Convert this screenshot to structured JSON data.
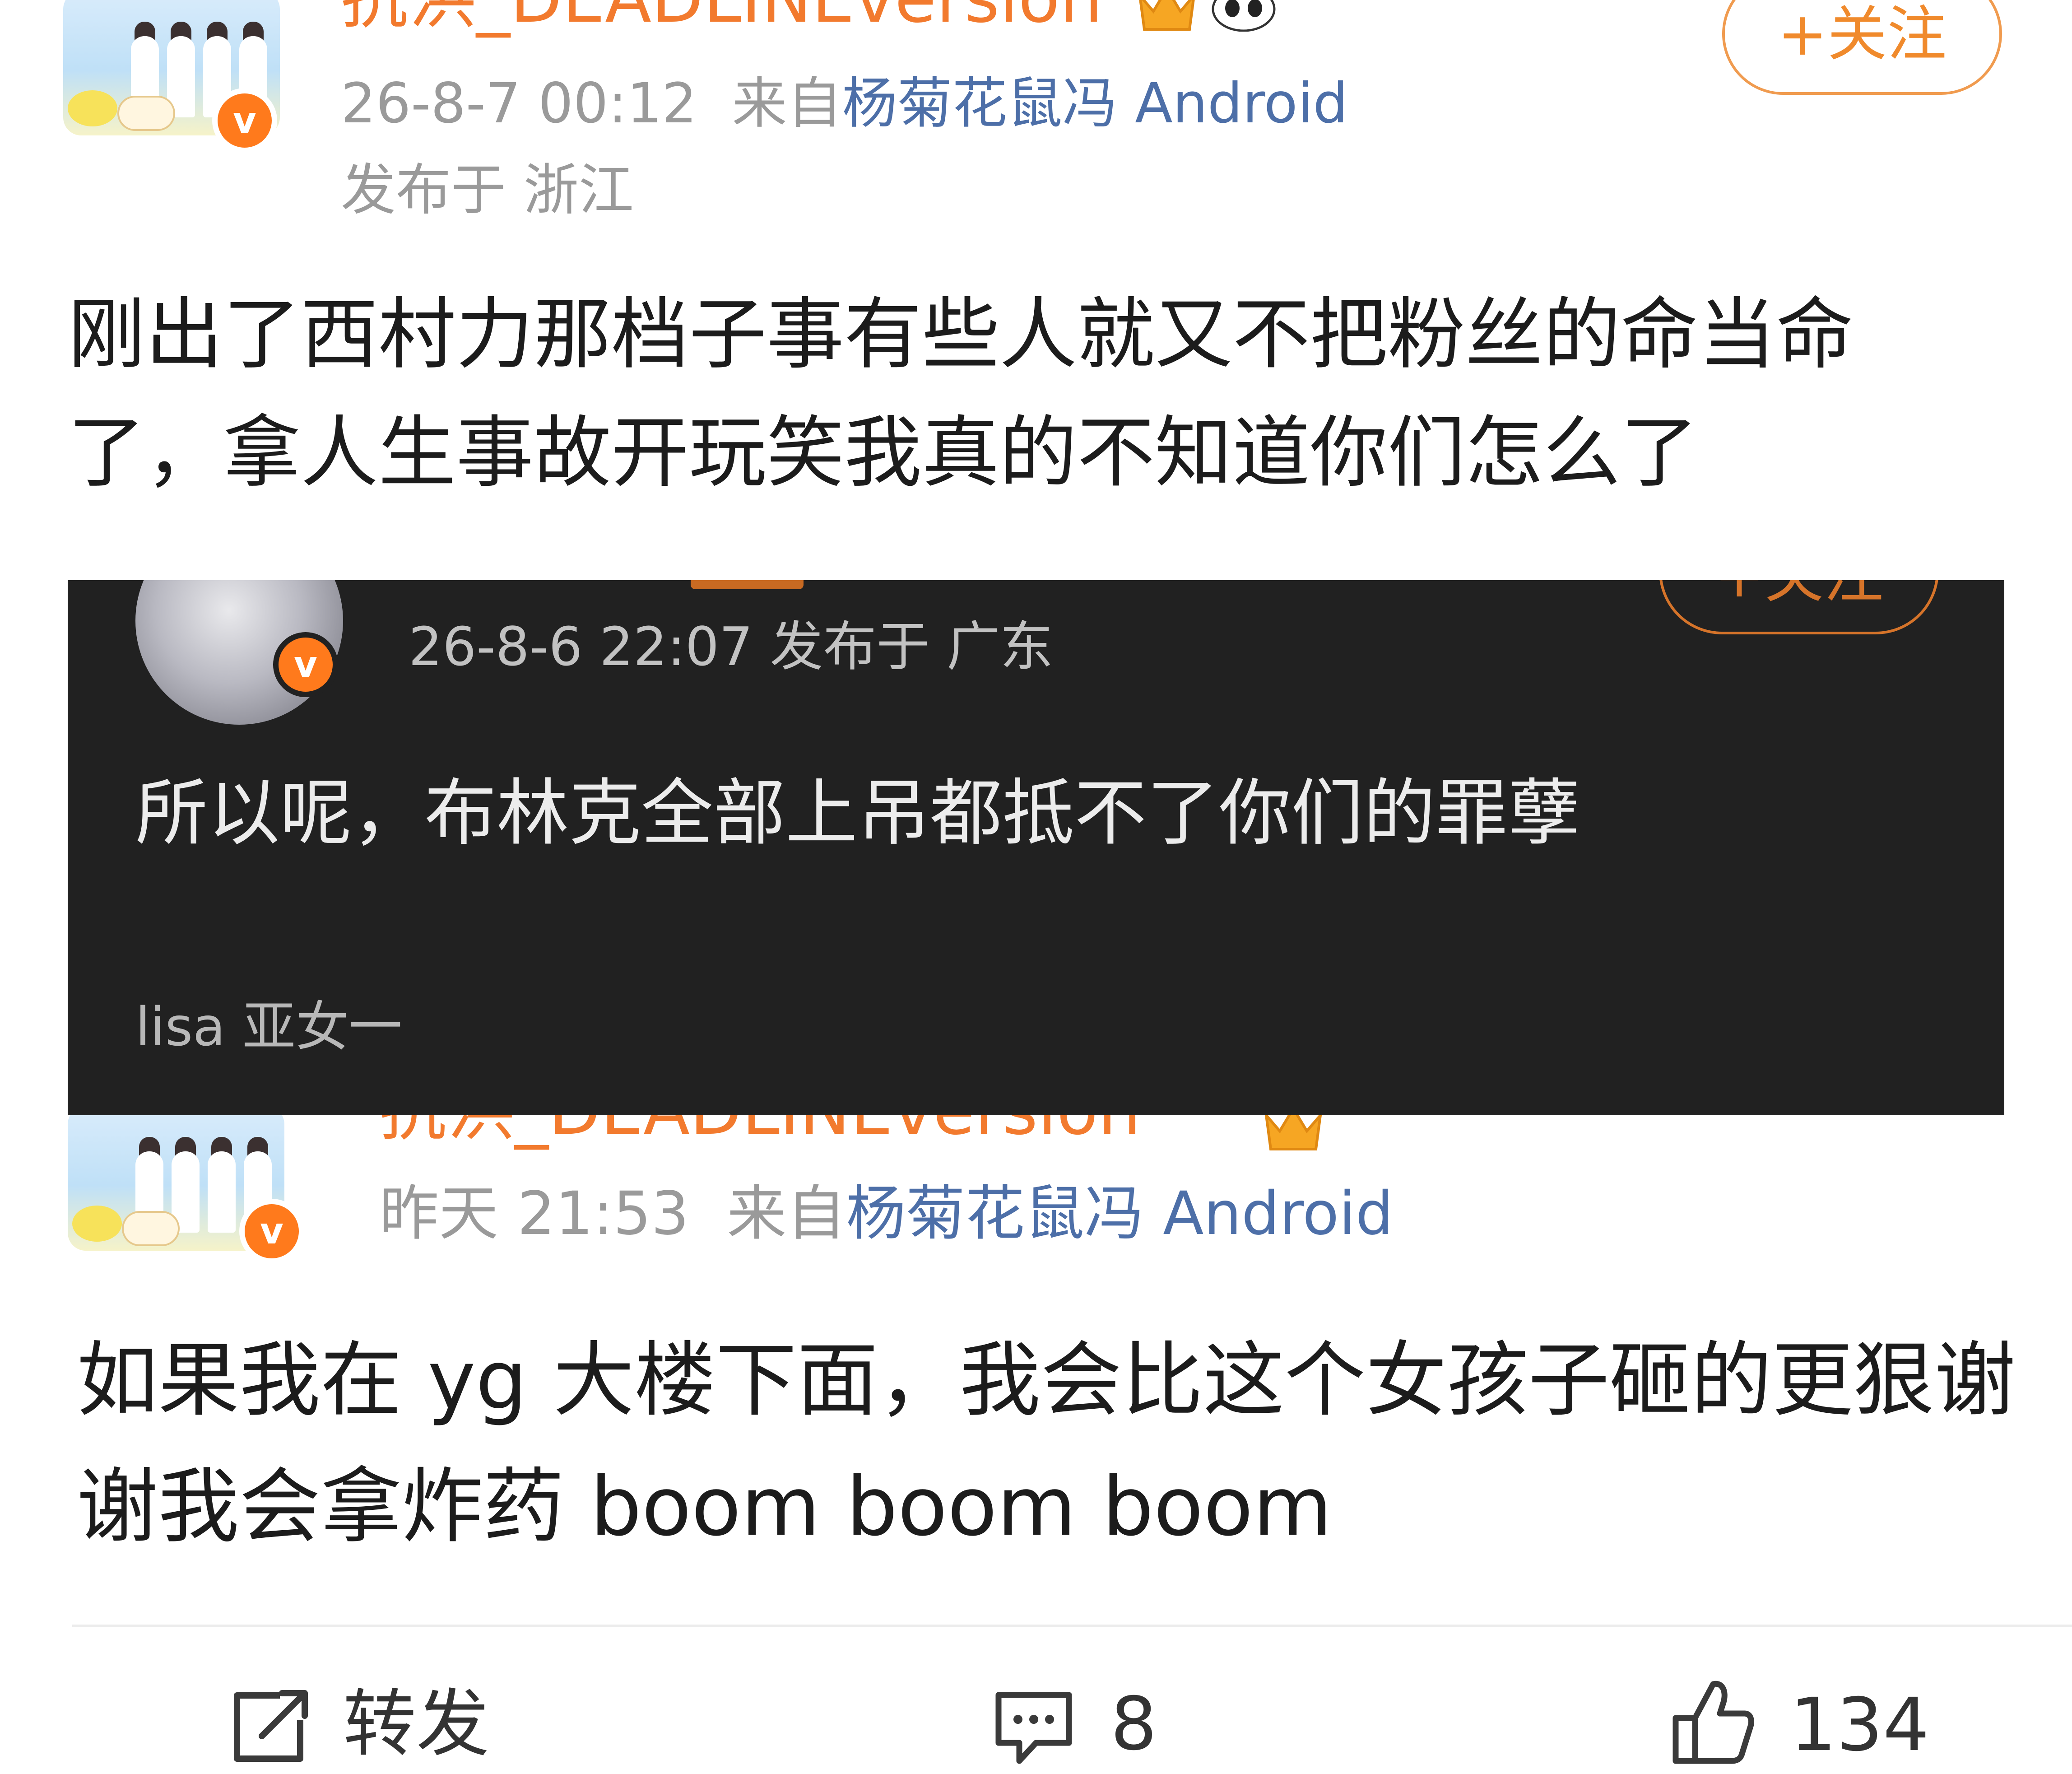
{
  "post1": {
    "username": "抗洪_DEADLINEversion",
    "time": "26-8-7 00:12",
    "source_prefix": "来自",
    "source_app": "杨菊花鼠冯 Android",
    "location": "发布于 浙江",
    "follow_label": "+关注",
    "body_line1": "刚出了西村力那档子事有些人就又不把粉丝的命当命",
    "body_line2": "了，拿人生事故开玩笑我真的不知道你们怎么了"
  },
  "quoted": {
    "meta": "26-8-6 22:07  发布于 广东",
    "body": "所以呢，布林克全部上吊都抵不了你们的罪孽",
    "watermark": "lisa 亚女一",
    "follow_label": "+关注"
  },
  "post2": {
    "username": "抗洪_DEADLINEversion",
    "time": "昨天 21:53",
    "source_prefix": "来自",
    "source_app": "杨菊花鼠冯 Android",
    "body_line1": "如果我在 yg 大楼下面，我会比这个女孩子砸的更狠谢",
    "body_line2": "谢我会拿炸药 boom boom boom"
  },
  "actions": {
    "repost_label": "转发",
    "comment_count": "8",
    "like_count": "134"
  },
  "badges": {
    "verified": "v"
  },
  "colors": {
    "username": "#f27a2e",
    "source_link": "#4d6fa8",
    "meta_gray": "#9a9a9a",
    "badge_orange": "#ff7a1c",
    "dark_card": "#212121"
  },
  "icons": [
    "crown-icon",
    "panda-icon",
    "verified-badge-icon",
    "repost-icon",
    "comment-icon",
    "like-icon"
  ]
}
